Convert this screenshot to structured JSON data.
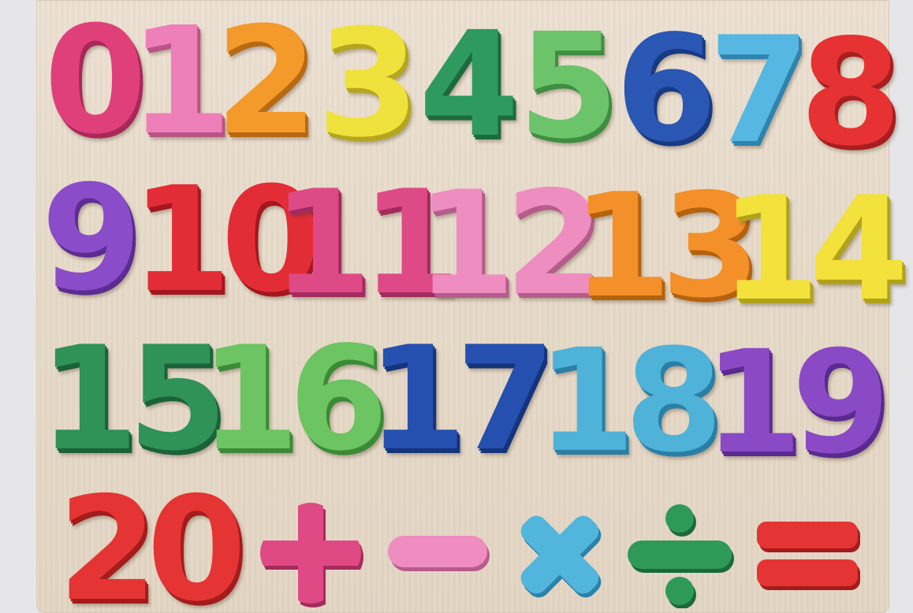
{
  "numbers": [
    {
      "label": "0",
      "color": "#e0407a",
      "shadow": "#a8285a"
    },
    {
      "label": "1",
      "color": "#ee7fb8",
      "shadow": "#b85586"
    },
    {
      "label": "2",
      "color": "#f39a2a",
      "shadow": "#b86a12"
    },
    {
      "label": "3",
      "color": "#f0e23c",
      "shadow": "#b4a61e"
    },
    {
      "label": "4",
      "color": "#2e9a5e",
      "shadow": "#1c6a3e"
    },
    {
      "label": "5",
      "color": "#6cc46a",
      "shadow": "#3e8e40"
    },
    {
      "label": "6",
      "color": "#2a56b4",
      "shadow": "#183a82"
    },
    {
      "label": "7",
      "color": "#56b8e2",
      "shadow": "#2e84ae"
    },
    {
      "label": "8",
      "color": "#e63232",
      "shadow": "#a81e1e"
    },
    {
      "label": "9",
      "color": "#8a4cc8",
      "shadow": "#5c2c92"
    },
    {
      "label": "10",
      "color": "#e32d36",
      "shadow": "#a5161e"
    },
    {
      "label": "11",
      "color": "#dd4a86",
      "shadow": "#a22a5e"
    },
    {
      "label": "12",
      "color": "#ee8ec0",
      "shadow": "#b55c8c"
    },
    {
      "label": "13",
      "color": "#f4902a",
      "shadow": "#b4620e"
    },
    {
      "label": "14",
      "color": "#f3e13c",
      "shadow": "#b0a21c"
    },
    {
      "label": "15",
      "color": "#2f9256",
      "shadow": "#1a6238"
    },
    {
      "label": "16",
      "color": "#6cc462",
      "shadow": "#3c8a36"
    },
    {
      "label": "17",
      "color": "#2550b0",
      "shadow": "#14347c"
    },
    {
      "label": "18",
      "color": "#4fb2d8",
      "shadow": "#2a7fa6"
    },
    {
      "label": "19",
      "color": "#8a4ac6",
      "shadow": "#5a2a90"
    },
    {
      "label": "20",
      "color": "#e53434",
      "shadow": "#a41c1c"
    }
  ],
  "symbols": [
    {
      "name": "plus",
      "color": "#e04a84",
      "shadow": "#a42c5c"
    },
    {
      "name": "minus",
      "color": "#ef8cc0",
      "shadow": "#b85a8c"
    },
    {
      "name": "multiply",
      "color": "#52b6dc",
      "shadow": "#2c82aa"
    },
    {
      "name": "divide",
      "color": "#2f9a58",
      "shadow": "#1b6a3a"
    },
    {
      "name": "equals",
      "color": "#e53434",
      "shadow": "#a41c1c"
    }
  ]
}
